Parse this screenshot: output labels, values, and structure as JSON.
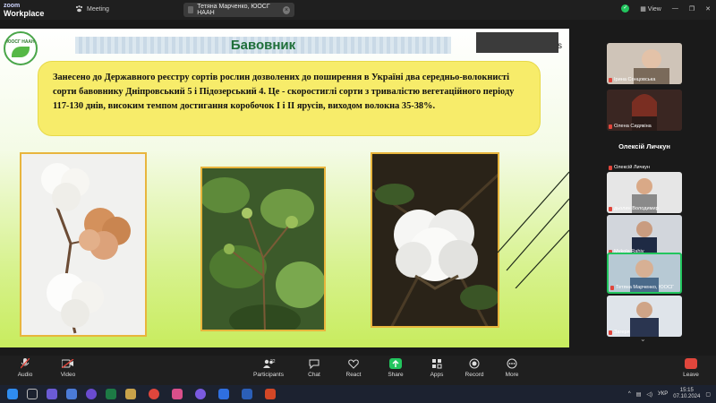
{
  "app": {
    "brand_line1": "zoom",
    "brand_line2": "Workplace",
    "meeting_label": "Meeting",
    "share_label": "Тетяна Марченко, ЮОСГ НААН",
    "view_label": "View"
  },
  "slide": {
    "logo_text": "ЮОСГ НААН",
    "title": "Бавовник",
    "body": "Занесено до Державного реєстру сортів рослин дозволених до поширення в Україні два середньо-волокнисті сорти бавовнику Дніпровський 5 і Підозерський 4. Це - скоростиглі сорти з тривалістю вегетаційного періоду 117-130 днів, високим темпом достигання коробочок І і ІІ ярусів, виходом волокна 35-38%."
  },
  "participants": {
    "speaker_label": "Олексій Личкун",
    "tiles": [
      {
        "name": "Ірина Сонцовська"
      },
      {
        "name": "Олена Сидякіна"
      },
      {
        "name": "Олексій Личкун"
      },
      {
        "name": "дьолин Володимир"
      },
      {
        "name": "Mykola Rahiv"
      },
      {
        "name": "Тетяна Марченко, ЮОСГ"
      },
      {
        "name": "Загеря"
      }
    ]
  },
  "toolbar": {
    "audio": "Audio",
    "video": "Video",
    "participants": "Participants",
    "participants_count": "22",
    "chat": "Chat",
    "react": "React",
    "share": "Share",
    "apps": "Apps",
    "record": "Record",
    "more": "More",
    "leave": "Leave"
  },
  "taskbar": {
    "lang": "УКР",
    "time": "15:15",
    "date": "07.10.2024"
  },
  "colors": {
    "accent_green": "#22c55e",
    "leave_red": "#e0463c",
    "slide_yellow": "#f7ec6a",
    "title_green": "#1f6f3a"
  }
}
